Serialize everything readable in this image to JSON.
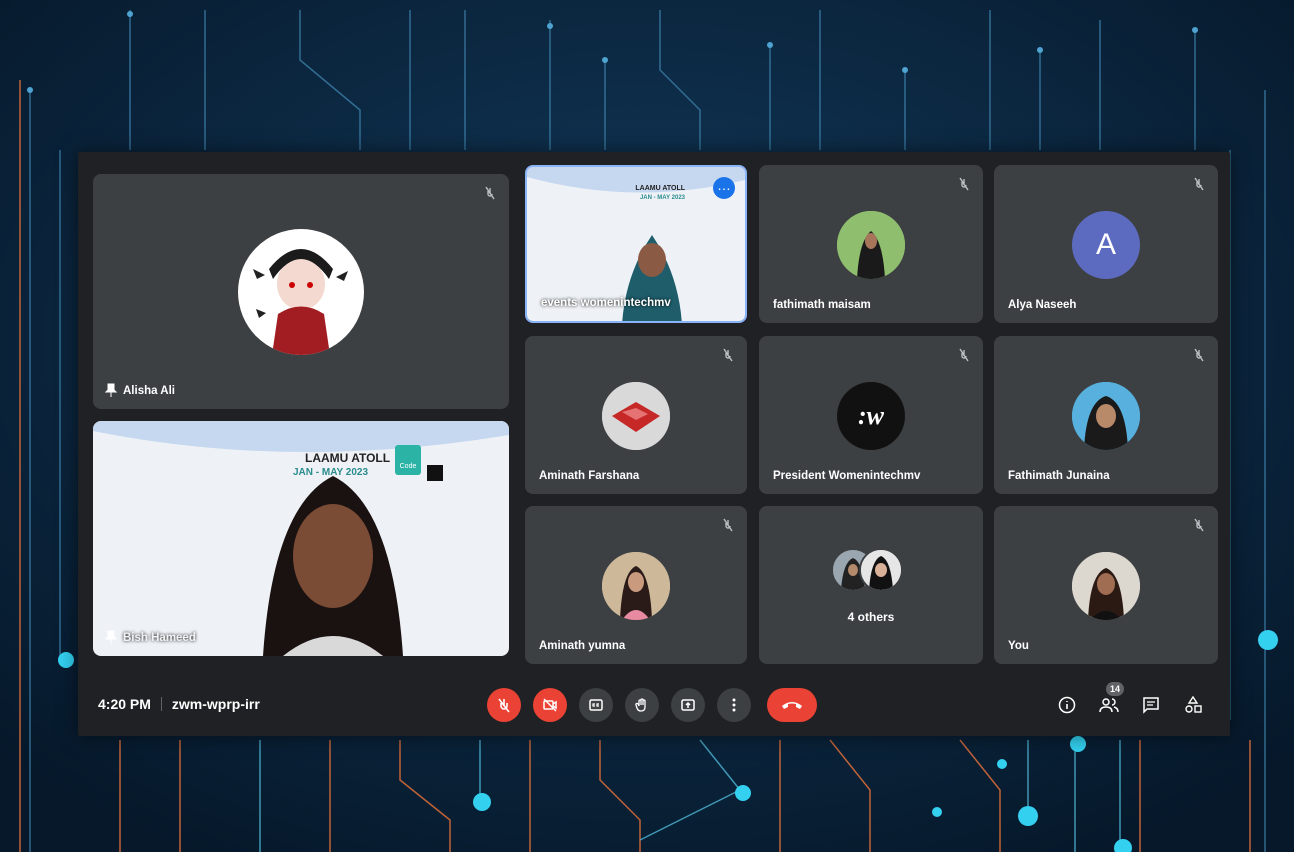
{
  "participants": {
    "alisha": {
      "name": "Alisha Ali"
    },
    "events": {
      "name": "events womenintechmv",
      "slide_title": "LAAMU ATOLL",
      "slide_sub": "JAN - MAY 2023"
    },
    "fathimath_maisam": {
      "name": "fathimath maisam"
    },
    "alya": {
      "name": "Alya Naseeh",
      "initial": "A",
      "color": "#5c6bc0"
    },
    "aminath_farshana": {
      "name": "Aminath Farshana"
    },
    "president": {
      "name": "President Womenintechmv",
      "logo_text": ":w"
    },
    "fathimath_junaina": {
      "name": "Fathimath Junaina"
    },
    "bish": {
      "name": "Bish Hameed",
      "slide_title": "LAAMU ATOLL",
      "slide_sub": "JAN - MAY 2023",
      "logo_label": "Code"
    },
    "aminath_yumna": {
      "name": "Aminath yumna"
    },
    "others": {
      "label": "4 others"
    },
    "you": {
      "name": "You"
    }
  },
  "meeting": {
    "time": "4:20 PM",
    "code": "zwm-wprp-irr"
  },
  "right_controls": {
    "people_count": "14"
  },
  "colors": {
    "danger": "#ea4335",
    "tile": "#3c4043",
    "surface": "#202124",
    "accent": "#8ab4f8"
  }
}
